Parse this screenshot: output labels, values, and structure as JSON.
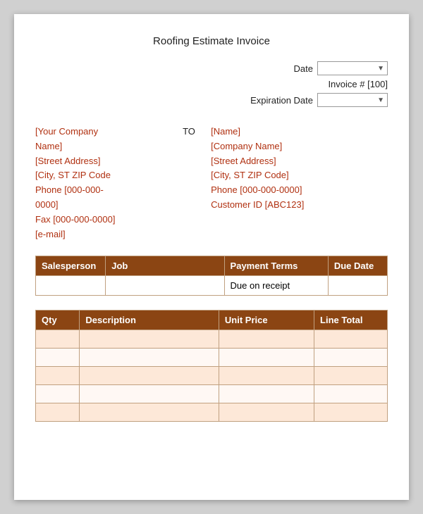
{
  "title": "Roofing Estimate Invoice",
  "header": {
    "date_label": "Date",
    "invoice_num": "Invoice # [100]",
    "expiration_label": "Expiration Date"
  },
  "from_address": {
    "line1": "[Your Company",
    "line2": "Name]",
    "line3": "[Street Address]",
    "line4": "[City, ST  ZIP Code",
    "line5": "Phone [000-000-",
    "line6": "0000]",
    "line7": "Fax [000-000-0000]",
    "line8": "[e-mail]"
  },
  "to_label": "TO",
  "to_address": {
    "line1": "[Name]",
    "line2": "[Company Name]",
    "line3": "[Street Address]",
    "line4": "[City, ST  ZIP Code]",
    "line5": "Phone [000-000-0000]",
    "line6": "Customer ID [ABC123]"
  },
  "sales_table": {
    "headers": [
      "Salesperson",
      "Job",
      "Payment Terms",
      "Due Date"
    ],
    "row": {
      "salesperson": "",
      "job": "",
      "payment_terms": "Due on receipt",
      "due_date": ""
    }
  },
  "items_table": {
    "headers": [
      "Qty",
      "Description",
      "Unit Price",
      "Line Total"
    ],
    "rows": [
      {
        "qty": "",
        "desc": "",
        "unit": "",
        "total": ""
      },
      {
        "qty": "",
        "desc": "",
        "unit": "",
        "total": ""
      },
      {
        "qty": "",
        "desc": "",
        "unit": "",
        "total": ""
      },
      {
        "qty": "",
        "desc": "",
        "unit": "",
        "total": ""
      },
      {
        "qty": "",
        "desc": "",
        "unit": "",
        "total": ""
      }
    ]
  }
}
